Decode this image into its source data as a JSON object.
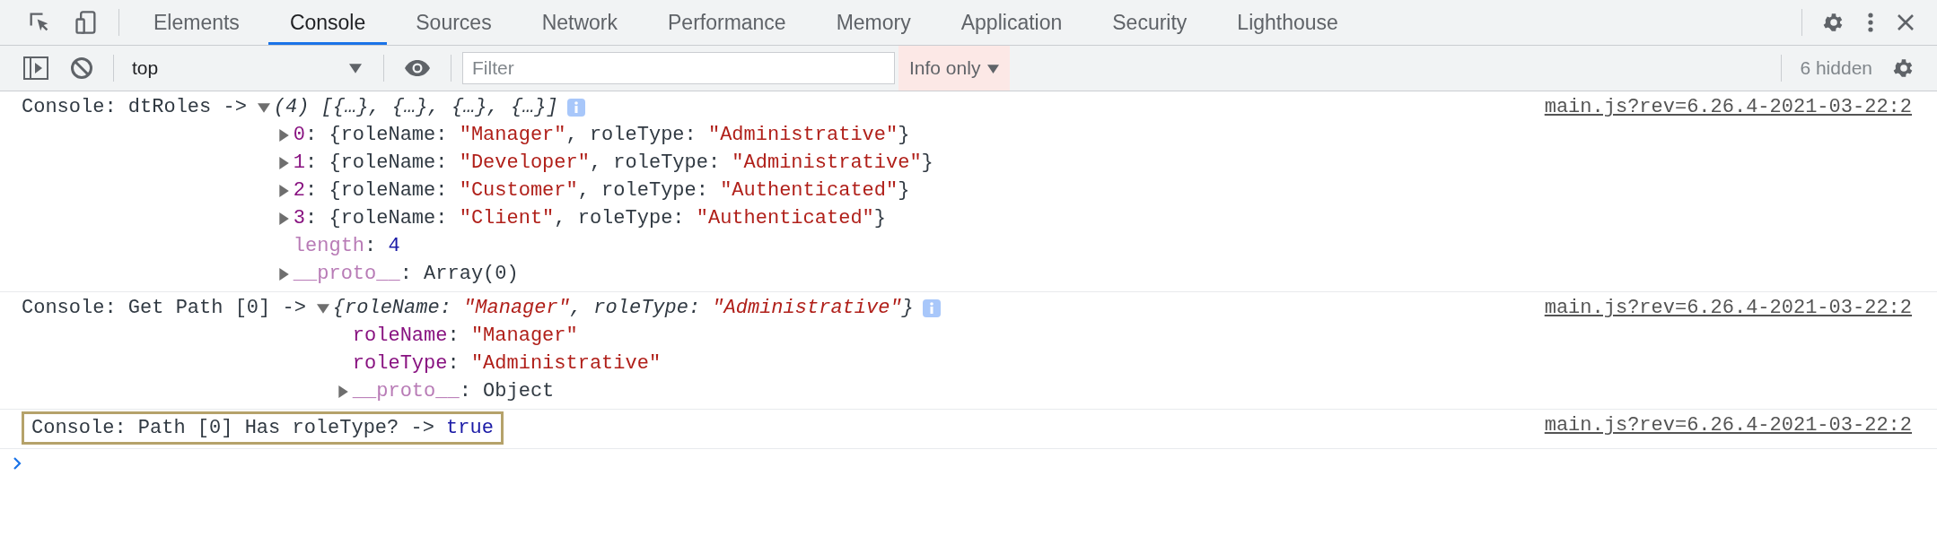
{
  "tabs": [
    {
      "label": "Elements",
      "selected": false
    },
    {
      "label": "Console",
      "selected": true
    },
    {
      "label": "Sources",
      "selected": false
    },
    {
      "label": "Network",
      "selected": false
    },
    {
      "label": "Performance",
      "selected": false
    },
    {
      "label": "Memory",
      "selected": false
    },
    {
      "label": "Application",
      "selected": false
    },
    {
      "label": "Security",
      "selected": false
    },
    {
      "label": "Lighthouse",
      "selected": false
    }
  ],
  "toolbar": {
    "context": "top",
    "filter_placeholder": "Filter",
    "levels": "Info only",
    "hidden_count": "6 hidden"
  },
  "messages": [
    {
      "kind": "tree",
      "prefix": "Console: dtRoles ->",
      "expanded": true,
      "summary": [
        {
          "kind": "plain",
          "text": "(4) [{…}, {…}, {…}, {…}]"
        }
      ],
      "source": "main.js?rev=6.26.4-2021-03-22:2",
      "highlighted": false,
      "children": [
        {
          "kind": "own",
          "key": "0",
          "expanded": false,
          "value": [
            {
              "kind": "plain",
              "text": ": {roleName: "
            },
            {
              "kind": "string",
              "text": "\"Manager\""
            },
            {
              "kind": "plain",
              "text": ", roleType: "
            },
            {
              "kind": "string",
              "text": "\"Administrative\""
            },
            {
              "kind": "plain",
              "text": "}"
            }
          ]
        },
        {
          "kind": "own",
          "key": "1",
          "expanded": false,
          "value": [
            {
              "kind": "plain",
              "text": ": {roleName: "
            },
            {
              "kind": "string",
              "text": "\"Developer\""
            },
            {
              "kind": "plain",
              "text": ", roleType: "
            },
            {
              "kind": "string",
              "text": "\"Administrative\""
            },
            {
              "kind": "plain",
              "text": "}"
            }
          ]
        },
        {
          "kind": "own",
          "key": "2",
          "expanded": false,
          "value": [
            {
              "kind": "plain",
              "text": ": {roleName: "
            },
            {
              "kind": "string",
              "text": "\"Customer\""
            },
            {
              "kind": "plain",
              "text": ", roleType: "
            },
            {
              "kind": "string",
              "text": "\"Authenticated\""
            },
            {
              "kind": "plain",
              "text": "}"
            }
          ]
        },
        {
          "kind": "own",
          "key": "3",
          "expanded": false,
          "value": [
            {
              "kind": "plain",
              "text": ": {roleName: "
            },
            {
              "kind": "string",
              "text": "\"Client\""
            },
            {
              "kind": "plain",
              "text": ", roleType: "
            },
            {
              "kind": "string",
              "text": "\"Authenticated\""
            },
            {
              "kind": "plain",
              "text": "}"
            }
          ]
        },
        {
          "kind": "internal",
          "key": "length",
          "value": [
            {
              "kind": "plain",
              "text": ": "
            },
            {
              "kind": "number",
              "text": "4"
            }
          ]
        },
        {
          "kind": "internal",
          "key": "__proto__",
          "expanded": false,
          "value": [
            {
              "kind": "plain",
              "text": ": Array(0)"
            }
          ]
        }
      ]
    },
    {
      "kind": "tree",
      "prefix": "Console: Get Path [0] ->",
      "expanded": true,
      "summary": [
        {
          "kind": "plain",
          "text": "{roleName: "
        },
        {
          "kind": "string",
          "text": "\"Manager\""
        },
        {
          "kind": "plain",
          "text": ", roleType: "
        },
        {
          "kind": "string",
          "text": "\"Administrative\""
        },
        {
          "kind": "plain",
          "text": "}"
        }
      ],
      "source": "main.js?rev=6.26.4-2021-03-22:2",
      "highlighted": false,
      "children": [
        {
          "kind": "own",
          "key": "roleName",
          "value": [
            {
              "kind": "plain",
              "text": ": "
            },
            {
              "kind": "string",
              "text": "\"Manager\""
            }
          ]
        },
        {
          "kind": "own",
          "key": "roleType",
          "value": [
            {
              "kind": "plain",
              "text": ": "
            },
            {
              "kind": "string",
              "text": "\"Administrative\""
            }
          ]
        },
        {
          "kind": "internal",
          "key": "__proto__",
          "expanded": false,
          "value": [
            {
              "kind": "plain",
              "text": ": Object"
            }
          ]
        }
      ]
    },
    {
      "kind": "plain",
      "prefix": "Console: Path [0] Has roleType? ->",
      "value": [
        {
          "kind": "boolean",
          "text": "true"
        }
      ],
      "source": "main.js?rev=6.26.4-2021-03-22:2",
      "highlighted": true
    }
  ]
}
